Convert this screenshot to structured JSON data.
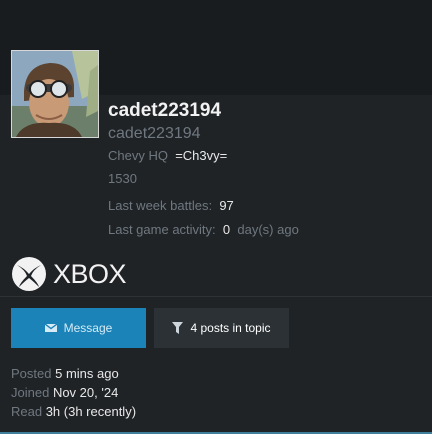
{
  "profile": {
    "username": "cadet223194",
    "handle": "cadet223194",
    "clan_label": "Chevy HQ",
    "clan_tag": "=Ch3vy=",
    "rating": "1530",
    "last_week_battles_label": "Last week battles",
    "last_week_battles_value": "97",
    "last_game_activity_label": "Last game activity",
    "last_game_activity_value": "0",
    "last_game_activity_unit": "day(s) ago"
  },
  "platform": {
    "name": "XBOX",
    "icon": "xbox-logo-icon"
  },
  "actions": {
    "message_label": "Message",
    "message_icon": "envelope-icon",
    "posts_label": "4 posts in topic",
    "posts_icon": "filter-icon"
  },
  "meta": {
    "posted_label": "Posted",
    "posted_value": "5 mins ago",
    "joined_label": "Joined",
    "joined_value": "Nov 20, '24",
    "read_label": "Read",
    "read_value": "3h (3h recently)"
  },
  "colors": {
    "background": "#1f2326",
    "accent_button": "#1b83b8",
    "secondary_button": "#2b3135",
    "muted_text": "#6f7880",
    "bright_text": "#e8e8e8"
  }
}
